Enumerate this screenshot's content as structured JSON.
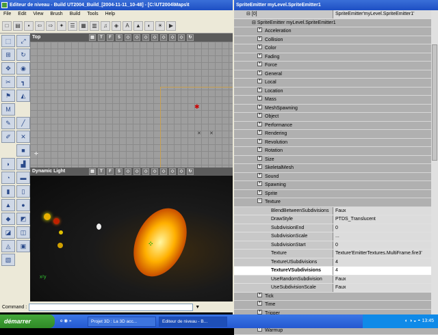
{
  "window_title": "Editeur de niveau - Build UT2004_Build_[2004-11-11_10-48] - [C:\\UT2004\\Maps\\t",
  "menu": [
    "File",
    "Edit",
    "View",
    "Brush",
    "Build",
    "Tools",
    "Help"
  ],
  "viewports": {
    "top": {
      "label": "Top"
    },
    "dynamic": {
      "label": "Dynamic Light"
    }
  },
  "command": {
    "label": "Command :",
    "value": ""
  },
  "properties": {
    "title": "SpriteEmitter myLevel.SpriteEmitter1",
    "root_name": "[0]",
    "root_value": "SpriteEmitter'myLevel.SpriteEmitter1'",
    "object_name": "SpriteEmitter myLevel.SpriteEmitter1",
    "categories_before": [
      "Acceleration",
      "Collision",
      "Color",
      "Fading",
      "Force",
      "General",
      "Local",
      "Location",
      "Mass",
      "MeshSpawning",
      "Object",
      "Performance",
      "Rendering",
      "Revolution",
      "Rotation",
      "Size",
      "SkeletalMesh",
      "Sound",
      "Spawning",
      "Sprite"
    ],
    "open_category": "Texture",
    "texture_items": [
      {
        "name": "BlendBetweenSubdivisions",
        "value": "Faux"
      },
      {
        "name": "DrawStyle",
        "value": "PTDS_Translucent"
      },
      {
        "name": "SubdivisionEnd",
        "value": "0"
      },
      {
        "name": "SubdivisionScale",
        "value": "..."
      },
      {
        "name": "SubdivisionStart",
        "value": "0"
      },
      {
        "name": "Texture",
        "value": "Texture'EmitterTextures.MultiFrame.fire3'"
      },
      {
        "name": "TextureUSubdivisions",
        "value": "4"
      },
      {
        "name": "TextureVSubdivisions",
        "value": "4"
      },
      {
        "name": "UseRandomSubdivision",
        "value": "Faux"
      },
      {
        "name": "UseSubdivisionScale",
        "value": "Faux"
      }
    ],
    "selected_item": "TextureVSubdivisions",
    "categories_after": [
      "Tick",
      "Time",
      "Trigger",
      "Velocity",
      "Warmup"
    ]
  },
  "taskbar": {
    "start": "démarrer",
    "tasks": [
      "Projet 3D : La 3D acc...",
      "Editeur de niveau - B..."
    ],
    "clock": "13:45"
  }
}
